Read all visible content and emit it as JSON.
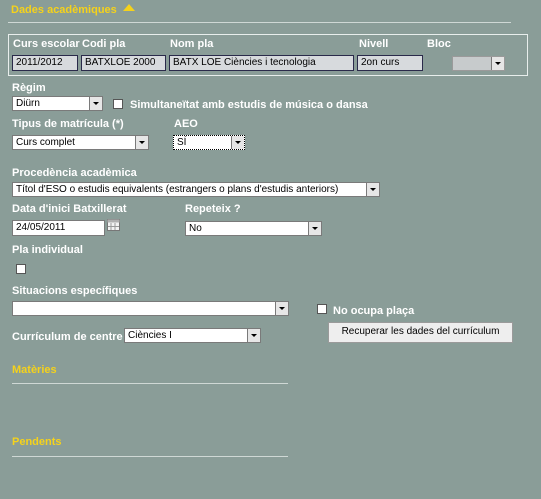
{
  "sections": {
    "dades_academiques": "Dades acadèmiques",
    "materies": "Matèries",
    "pendents": "Pendents"
  },
  "table": {
    "headers": [
      "Curs escolar",
      "Codi pla",
      "Nom pla",
      "Nivell",
      "Bloc"
    ],
    "curs_escolar": "2011/2012",
    "codi_pla": "BATXLOE 2000",
    "nom_pla": "BATX LOE Ciències i tecnologia",
    "nivell": "2on curs",
    "bloc": ""
  },
  "form": {
    "regim_label": "Règim",
    "regim_value": "Diürn",
    "simultaneitat_label": "Simultaneïtat amb estudis de música o dansa",
    "tipus_label": "Tipus de matrícula (*)",
    "tipus_value": "Curs complet",
    "aeo_label": "AEO",
    "aeo_value": "SÍ",
    "procedencia_label": "Procedència acadèmica",
    "procedencia_value": "Títol d'ESO o estudis equivalents (estrangers o plans d'estudis anteriors)",
    "data_label": "Data d'inici Batxillerat",
    "data_value": "24/05/2011",
    "repeteix_label": "Repeteix ?",
    "repeteix_value": "No",
    "pla_individual_label": "Pla individual",
    "situacions_label": "Situacions específiques",
    "situacions_value": "",
    "no_ocupa_label": "No ocupa plaça",
    "curriculum_label": "Currículum de centre",
    "curriculum_value": "Ciències I",
    "recuperar_button": "Recuperar les dades del currículum"
  },
  "colors": {
    "background": "#8a9d98",
    "section_title": "#f5d21b",
    "label": "#ffffff"
  }
}
